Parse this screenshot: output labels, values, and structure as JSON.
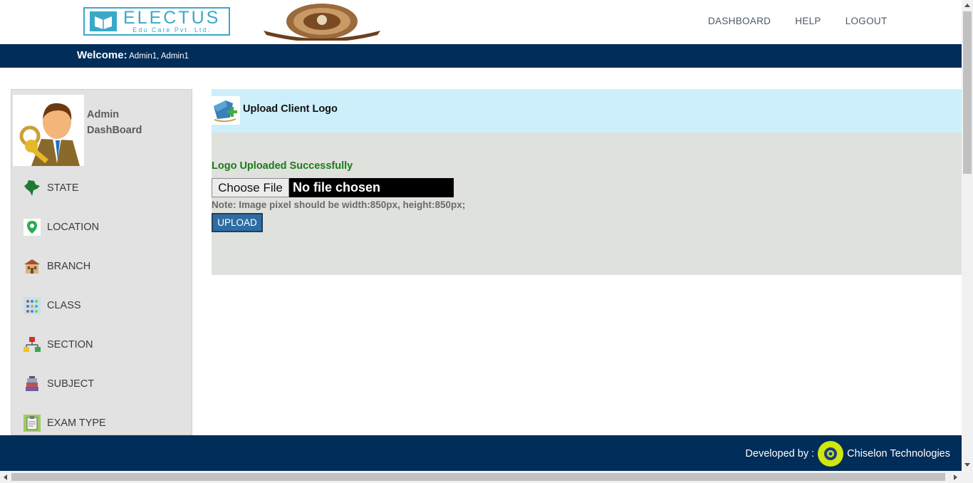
{
  "brand": {
    "name": "ELECTUS",
    "tagline": "Edu Care Pvt. Ltd."
  },
  "topnav": [
    {
      "label": "DASHBOARD"
    },
    {
      "label": "HELP"
    },
    {
      "label": "LOGOUT"
    }
  ],
  "welcome": {
    "label": "Welcome:",
    "user": " Admin1, Admin1"
  },
  "sidebar": {
    "title_line1": "Admin",
    "title_line2": "DashBoard",
    "items": [
      {
        "label": "STATE",
        "icon": "india-map-icon"
      },
      {
        "label": "LOCATION",
        "icon": "location-pin-icon"
      },
      {
        "label": "BRANCH",
        "icon": "building-icon"
      },
      {
        "label": "CLASS",
        "icon": "students-icon"
      },
      {
        "label": "SECTION",
        "icon": "hierarchy-icon"
      },
      {
        "label": "SUBJECT",
        "icon": "books-icon"
      },
      {
        "label": "EXAM TYPE",
        "icon": "clipboard-icon"
      }
    ]
  },
  "panel": {
    "title": "Upload Client Logo",
    "success": "Logo Uploaded Successfully",
    "choose_label": "Choose File",
    "no_file": "No file chosen",
    "note": "Note: Image pixel should be width:850px, height:850px;",
    "upload_label": "UPLOAD"
  },
  "footer": {
    "developed_by": "Developed by :",
    "company": " Chiselon Technologies"
  },
  "colors": {
    "navbar": "#002d59",
    "panel_header": "#cdeffc",
    "panel_body": "#dfe1dc",
    "success": "#1c7a1c",
    "upload_button": "#2e6da4"
  }
}
